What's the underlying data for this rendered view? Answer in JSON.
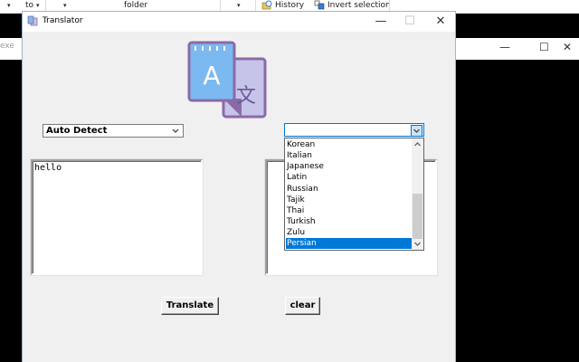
{
  "background": {
    "ribbon": {
      "to_label": "to",
      "folder_label": "folder",
      "history_label": "History",
      "invert_selection_label": "Invert selection"
    },
    "back_window": {
      "partial_title": "exe",
      "min_glyph": "—",
      "max_glyph": "☐",
      "close_glyph": "✕"
    }
  },
  "window": {
    "title": "Translator",
    "minimize_glyph": "—",
    "maximize_glyph": "☐",
    "close_glyph": "✕",
    "logo_letter_a": "A",
    "logo_letter_other": "文"
  },
  "source_language": {
    "selected": "Auto Detect",
    "icon": "chevron-down-icon"
  },
  "target_language": {
    "selected": "",
    "icon": "chevron-down-icon",
    "options": [
      "Korean",
      "Italian",
      "Japanese",
      "Latin",
      "Russian",
      "Tajik",
      "Thai",
      "Turkish",
      "Zulu",
      "Persian"
    ],
    "highlighted": "Persian"
  },
  "input_text": "hello",
  "output_text": "",
  "buttons": {
    "translate": "Translate",
    "clear": "clear"
  },
  "colors": {
    "selection": "#0078d7",
    "logo_front": "#7cb9f0",
    "logo_back": "#c7c4e9",
    "logo_outline": "#8b6aa8"
  }
}
